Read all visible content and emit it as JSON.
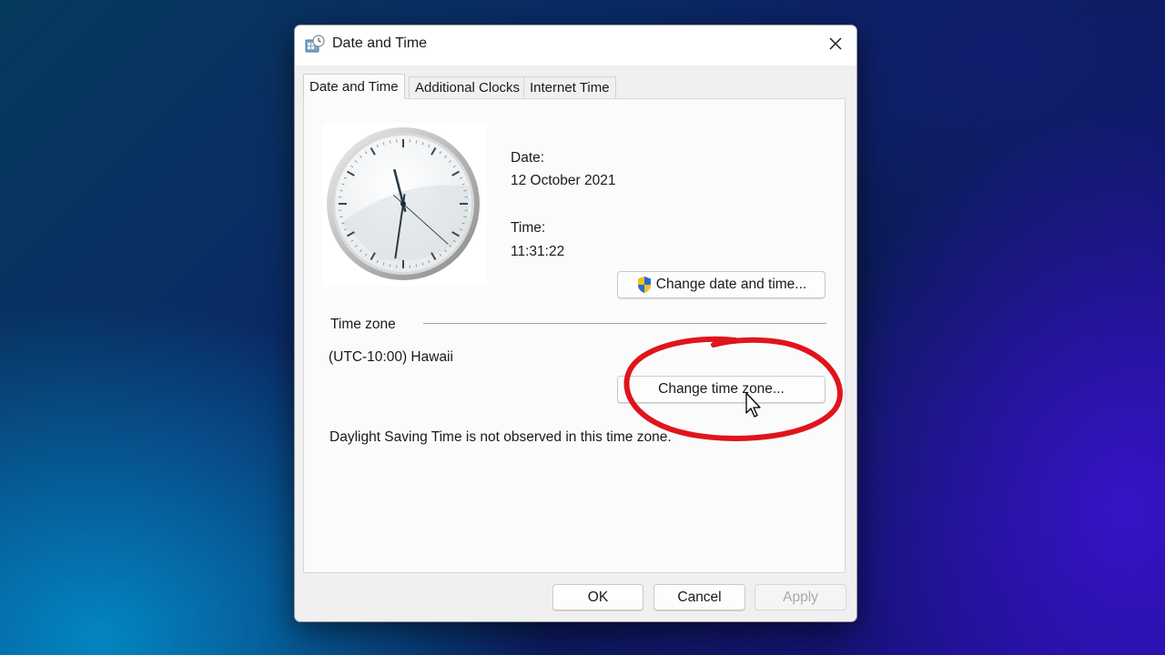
{
  "window": {
    "title": "Date and Time",
    "icon": "clock-settings-icon",
    "close_icon": "close-icon"
  },
  "tabs": [
    {
      "label": "Date and Time",
      "active": true
    },
    {
      "label": "Additional Clocks",
      "active": false
    },
    {
      "label": "Internet Time",
      "active": false
    }
  ],
  "datetime": {
    "date_label": "Date:",
    "date_value": "12 October 2021",
    "time_label": "Time:",
    "time_value": "11:31:22",
    "change_button": "Change date and time...",
    "change_button_icon": "uac-shield-icon"
  },
  "timezone": {
    "section_label": "Time zone",
    "value": "(UTC-10:00) Hawaii",
    "change_button": "Change time zone...",
    "dst_note": "Daylight Saving Time is not observed in this time zone."
  },
  "footer": {
    "ok": "OK",
    "cancel": "Cancel",
    "apply": "Apply"
  },
  "annotation": {
    "color": "#e0141c",
    "shape": "hand-drawn-ellipse"
  },
  "clock": {
    "hour": 11,
    "minute": 31,
    "second": 22
  }
}
